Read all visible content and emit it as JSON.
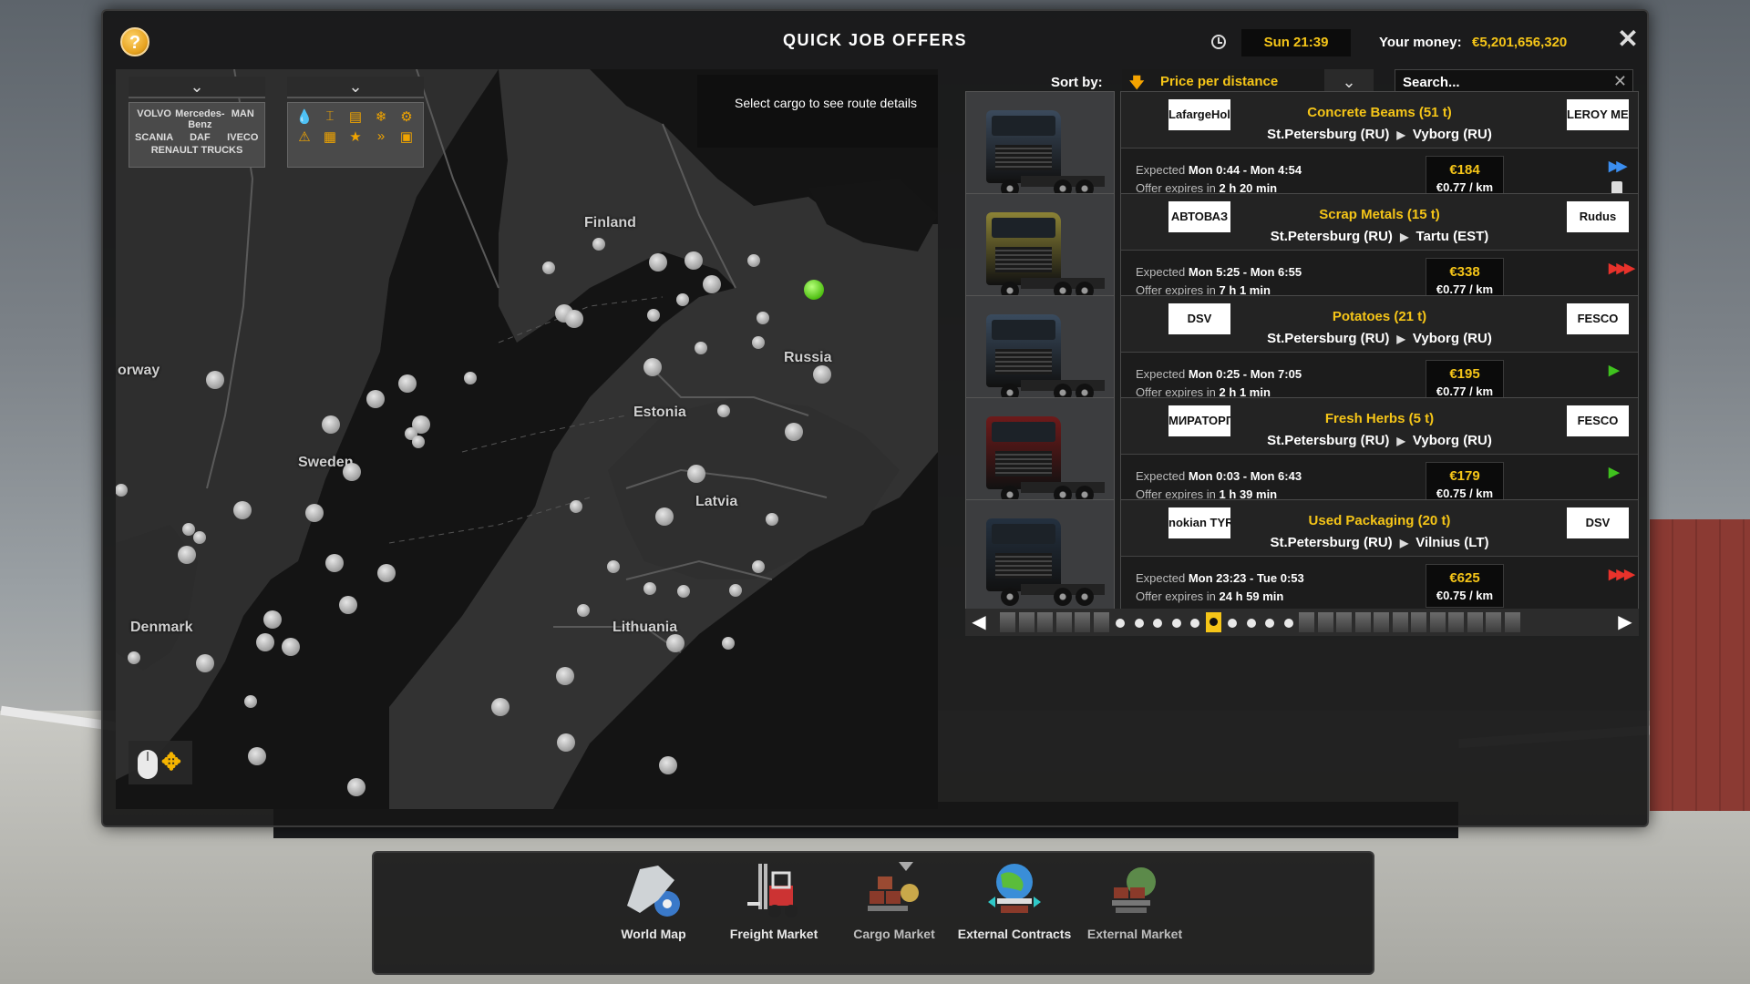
{
  "window": {
    "title": "QUICK JOB OFFERS",
    "help_label": "?",
    "time": "Sun 21:39",
    "money_label": "Your money:",
    "money_value": "€5,201,656,320",
    "close_label": "✕"
  },
  "map": {
    "route_hint": "Select cargo to see route details",
    "labels": [
      "Finland",
      "orway",
      "Russia",
      "Estonia",
      "Sweden",
      "Latvia",
      "Denmark",
      "Lithuania"
    ],
    "brand_filter_items": [
      "VOLVO",
      "Mercedes-Benz",
      "MAN",
      "SCANIA",
      "DAF",
      "IVECO",
      "RENAULT TRUCKS"
    ],
    "cargo_filter_icons": [
      "liquid-icon",
      "crane-icon",
      "container-icon",
      "snowflake-icon",
      "fragile-icon",
      "adr-icon",
      "oversize-icon",
      "star-icon",
      "urgency-icon"
    ]
  },
  "sort": {
    "label": "Sort by:",
    "selected": "Price per distance",
    "arrow_glyph": "🡇",
    "dropdown_glyph": "⌄"
  },
  "search": {
    "placeholder": "Search..."
  },
  "jobs": [
    {
      "cargo": "Concrete Beams (51 t)",
      "from": "St.Petersburg (RU)",
      "to": "Vyborg (RU)",
      "expected_label": "Expected",
      "expected": "Mon 0:44 - Mon 4:54",
      "expires_label": "Offer expires in",
      "expires": "2 h 20 min",
      "price": "€184",
      "rate": "€0.77 / km",
      "logo_from": "LafargeHolcim",
      "logo_to": "LEROY MERLIN",
      "urgency_icon": "double-arrow-icon",
      "urgency_glyph": "▶▶",
      "urgency_color": "#3b8ef0",
      "truck_color": "#3b4a5c"
    },
    {
      "cargo": "Scrap Metals (15 t)",
      "from": "St.Petersburg (RU)",
      "to": "Tartu (EST)",
      "expected_label": "Expected",
      "expected": "Mon 5:25 - Mon 6:55",
      "expires_label": "Offer expires in",
      "expires": "7 h 1 min",
      "price": "€338",
      "rate": "€0.77 / km",
      "logo_from": "АВТОВАЗ",
      "logo_to": "Rudus",
      "urgency_icon": "triple-arrow-icon",
      "urgency_glyph": "▶▶▶",
      "urgency_color": "#e8322b",
      "truck_color": "#8c8336"
    },
    {
      "cargo": "Potatoes (21 t)",
      "from": "St.Petersburg (RU)",
      "to": "Vyborg (RU)",
      "expected_label": "Expected",
      "expected": "Mon 0:25 - Mon 7:05",
      "expires_label": "Offer expires in",
      "expires": "2 h 1 min",
      "price": "€195",
      "rate": "€0.77 / km",
      "logo_from": "DSV",
      "logo_to": "FESCO",
      "urgency_icon": "single-arrow-icon",
      "urgency_glyph": "▶",
      "urgency_color": "#3fc21e",
      "truck_color": "#3a4b5e"
    },
    {
      "cargo": "Fresh Herbs (5 t)",
      "from": "St.Petersburg (RU)",
      "to": "Vyborg (RU)",
      "expected_label": "Expected",
      "expected": "Mon 0:03 - Mon 6:43",
      "expires_label": "Offer expires in",
      "expires": "1 h 39 min",
      "price": "€179",
      "rate": "€0.75 / km",
      "logo_from": "МИРАТОРГ",
      "logo_to": "FESCO",
      "urgency_icon": "single-arrow-icon",
      "urgency_glyph": "▶",
      "urgency_color": "#3fc21e",
      "truck_color": "#6e1a1a"
    },
    {
      "cargo": "Used Packaging (20 t)",
      "from": "St.Petersburg (RU)",
      "to": "Vilnius (LT)",
      "expected_label": "Expected",
      "expected": "Mon 23:23 - Tue 0:53",
      "expires_label": "Offer expires in",
      "expires": "24 h 59 min",
      "price": "€625",
      "rate": "€0.75 / km",
      "logo_from": "nokian TYRES",
      "logo_to": "DSV",
      "urgency_icon": "triple-arrow-icon",
      "urgency_glyph": "▶▶▶",
      "urgency_color": "#e8322b",
      "truck_color": "#243140"
    }
  ],
  "pager": {
    "prev_glyph": "◀",
    "next_glyph": "▶",
    "current_page": 11
  },
  "dock": {
    "items": [
      {
        "label": "World Map",
        "active": true
      },
      {
        "label": "Freight Market",
        "active": true
      },
      {
        "label": "Cargo Market",
        "active": false
      },
      {
        "label": "External Contracts",
        "active": true
      },
      {
        "label": "External Market",
        "active": false
      }
    ]
  },
  "colors": {
    "accent": "#f5c518",
    "panel": "#1c1c1c",
    "active_dot": "#4fbf12"
  }
}
